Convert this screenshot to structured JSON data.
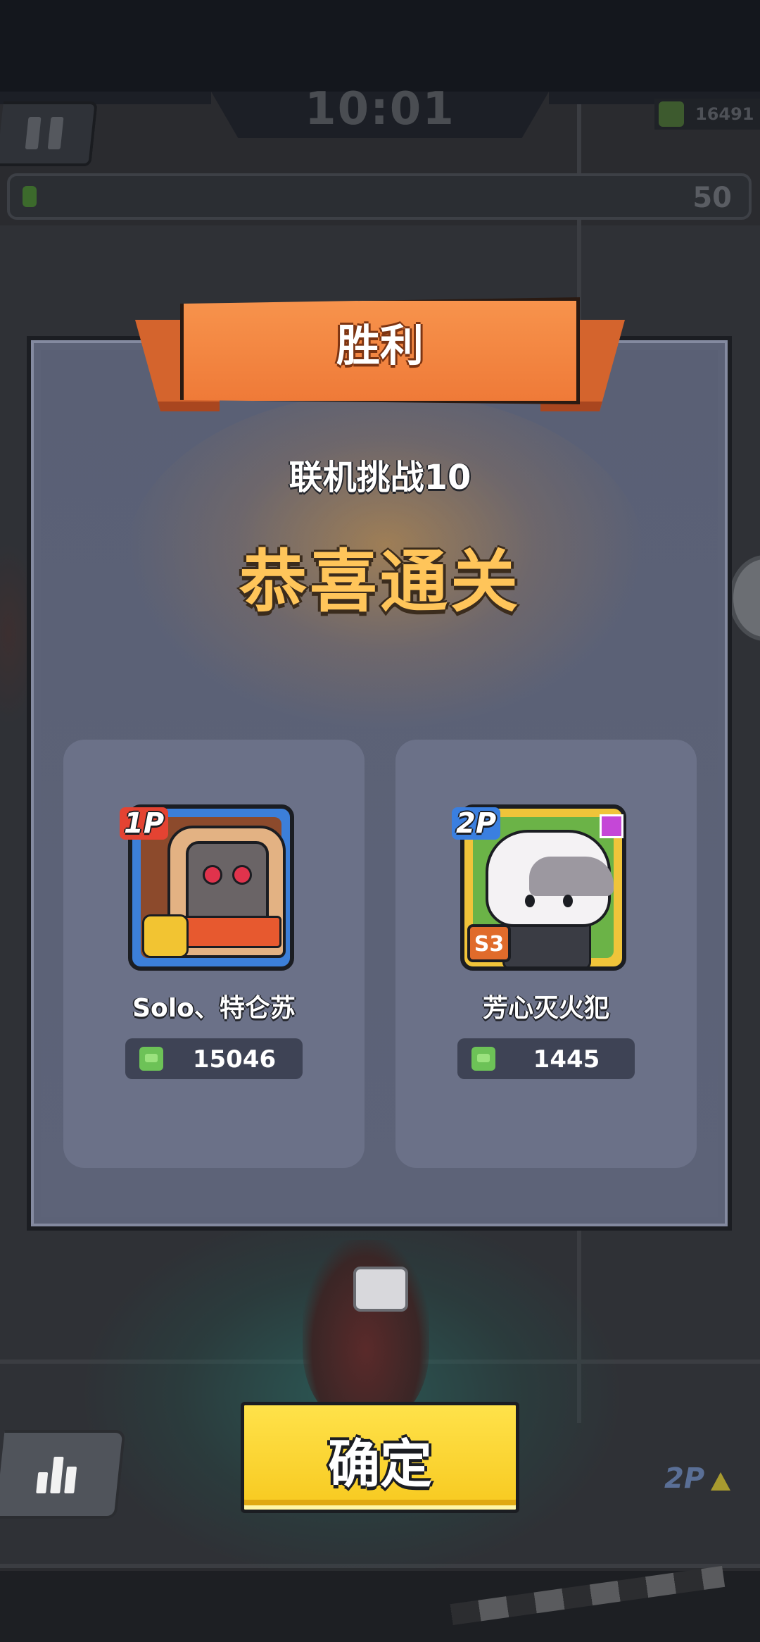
{
  "hud": {
    "timer": "10:01",
    "coins": "16491",
    "progress_value": "50",
    "progress_fraction": 0.02
  },
  "dialog": {
    "banner_title": "胜利",
    "challenge_label": "联机挑战10",
    "result_text": "恭喜通关"
  },
  "players": [
    {
      "tag": "1P",
      "name": "Solo、特仑苏",
      "score": "15046",
      "avatar": "hooded-robot"
    },
    {
      "tag": "2P",
      "name": "芳心灭火犯",
      "score": "1445",
      "avatar": "gray-cat",
      "season": "S3"
    }
  ],
  "actions": {
    "confirm_label": "确定"
  },
  "background": {
    "indicator_tag": "2P"
  },
  "colors": {
    "ribbon": "#ef7a38",
    "congrats": "#ffc55a",
    "confirm": "#f7c91f",
    "card": "#6b7188",
    "dialog": "#5c6277"
  },
  "icons": {
    "pause": "pause-icon",
    "coin": "green-coin-icon",
    "stats": "bar-chart-icon"
  }
}
